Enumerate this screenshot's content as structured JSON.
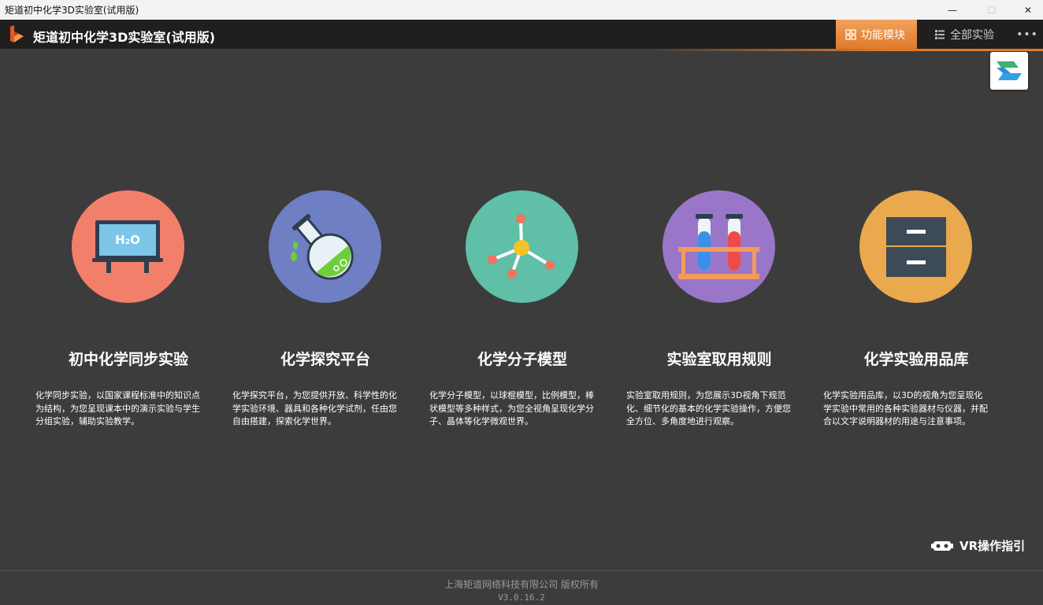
{
  "window": {
    "title": "矩道初中化学3D实验室(试用版)",
    "minimize_glyph": "—",
    "maximize_glyph": "☐",
    "close_glyph": "✕"
  },
  "header": {
    "app_title": "矩道初中化学3D实验室(试用版)",
    "tabs": [
      {
        "label": "功能模块",
        "icon": "grid-icon",
        "active": true
      },
      {
        "label": "全部实验",
        "icon": "list-icon",
        "active": false
      }
    ],
    "more_glyph": "•••"
  },
  "colors": {
    "accent": "#e07a2a",
    "background": "#3c3c3c",
    "header": "#1f1f1f",
    "module1": "#f27f6a",
    "module2": "#6f7fc4",
    "module3": "#5fbfa7",
    "module4": "#9a76c8",
    "module5": "#e9a94c"
  },
  "modules": [
    {
      "title": "初中化学同步实验",
      "icon": "blackboard-h2o-icon",
      "icon_text": "H₂O",
      "description": "化学同步实验，以国家课程标准中的知识点为结构，为您呈现课本中的演示实验与学生分组实验，辅助实验教学。"
    },
    {
      "title": "化学探究平台",
      "icon": "flask-icon",
      "description": "化学探究平台，为您提供开放、科学性的化学实验环境、器具和各种化学试剂，任由您自由搭建，探索化学世界。"
    },
    {
      "title": "化学分子模型",
      "icon": "molecule-icon",
      "description": "化学分子模型，以球棍模型，比例模型，棒状模型等多种样式，为您全视角呈现化学分子、晶体等化学微观世界。"
    },
    {
      "title": "实验室取用规则",
      "icon": "test-tubes-icon",
      "description": "实验室取用规则，为您展示3D视角下规范化、细节化的基本的化学实验操作，方便您全方位、多角度地进行观察。"
    },
    {
      "title": "化学实验用品库",
      "icon": "cabinet-icon",
      "description": "化学实验用品库，以3D的视角为您呈现化学实验中常用的各种实验器材与仪器，并配合以文字说明器材的用途与注意事项。"
    }
  ],
  "vr": {
    "label": "VR操作指引",
    "icon": "vr-headset-icon"
  },
  "footer": {
    "copyright": "上海矩道网络科技有限公司 版权所有",
    "version": "V3.0.16.2"
  }
}
